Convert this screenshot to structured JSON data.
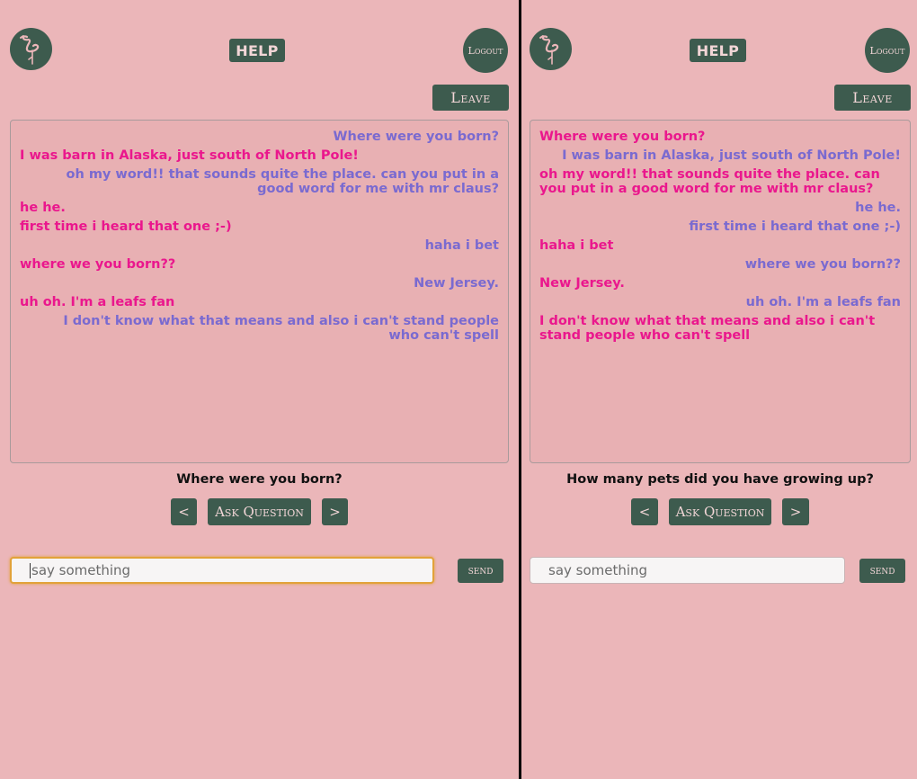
{
  "panels": [
    {
      "help_label": "HELP",
      "logout_label": "Logout",
      "leave_label": "Leave",
      "messages": [
        {
          "side": "self",
          "text": "Where were you born?"
        },
        {
          "side": "other",
          "text": "I was barn in Alaska, just south of North Pole!"
        },
        {
          "side": "self",
          "text": "oh my word!! that sounds quite the place. can you put in a good word for me with mr claus?"
        },
        {
          "side": "other",
          "text": "he he."
        },
        {
          "side": "other",
          "text": "first time i heard that one ;-)"
        },
        {
          "side": "self",
          "text": "haha i bet"
        },
        {
          "side": "other",
          "text": "where we you born??"
        },
        {
          "side": "self",
          "text": "New Jersey."
        },
        {
          "side": "other",
          "text": "uh oh. I'm a leafs fan"
        },
        {
          "side": "self",
          "text": "I don't know what that means and also i can't stand people who can't spell"
        }
      ],
      "question": "Where were you born?",
      "prev_label": "<",
      "ask_label": "Ask Question",
      "next_label": ">",
      "input_placeholder": "say something",
      "send_label": "send"
    },
    {
      "help_label": "HELP",
      "logout_label": "Logout",
      "leave_label": "Leave",
      "messages": [
        {
          "side": "other",
          "text": "Where were you born?"
        },
        {
          "side": "self",
          "text": "I was barn in Alaska, just south of North Pole!"
        },
        {
          "side": "other",
          "text": "oh my word!! that sounds quite the place. can you put in a good word for me with mr claus?"
        },
        {
          "side": "self",
          "text": "he he."
        },
        {
          "side": "self",
          "text": "first time i heard that one ;-)"
        },
        {
          "side": "other",
          "text": "haha i bet"
        },
        {
          "side": "self",
          "text": "where we you born??"
        },
        {
          "side": "other",
          "text": "New Jersey."
        },
        {
          "side": "self",
          "text": "uh oh. I'm a leafs fan"
        },
        {
          "side": "other",
          "text": "I don't know what that means and also i can't stand people who can't spell"
        }
      ],
      "question": "How many pets did you have growing up?",
      "prev_label": "<",
      "ask_label": "Ask Question",
      "next_label": ">",
      "input_placeholder": "say something",
      "send_label": "send"
    }
  ],
  "icons": {
    "logo": "flamingo-icon"
  },
  "colors": {
    "background": "#ebb6b9",
    "button": "#3d5b4e",
    "self_message": "#7a6ad0",
    "other_message": "#ea178d"
  }
}
